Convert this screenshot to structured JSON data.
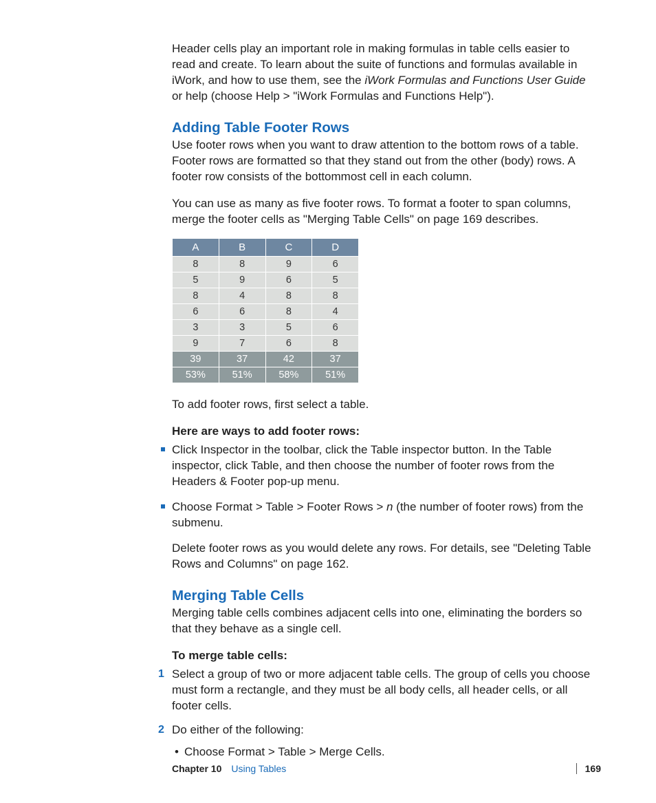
{
  "intro_para": {
    "pre": "Header cells play an important role in making formulas in table cells easier to read and create. To learn about the suite of functions and formulas available in iWork, and how to use them, see the ",
    "ital": "iWork Formulas and Functions User Guide",
    "post": " or help (choose Help > \"iWork Formulas and Functions Help\")."
  },
  "section1": {
    "heading": "Adding Table Footer Rows",
    "p1": "Use footer rows when you want to draw attention to the bottom rows of a table. Footer rows are formatted so that they stand out from the other (body) rows. A footer row consists of the bottommost cell in each column.",
    "p2": "You can use as many as five footer rows. To format a footer to span columns, merge the footer cells as \"Merging Table Cells\" on page 169 describes.",
    "after_table": "To add footer rows, first select a table.",
    "ways_heading": "Here are ways to add footer rows:",
    "bullets": [
      "Click Inspector in the toolbar, click the Table inspector button. In the Table inspector, click Table, and then choose the number of footer rows from the Headers & Footer pop-up menu.",
      {
        "pre": "Choose Format > Table > Footer Rows > ",
        "ital": "n",
        "post": " (the number of footer rows) from the submenu."
      }
    ],
    "delete_para": "Delete footer rows as you would delete any rows. For details, see \"Deleting Table Rows and Columns\" on page 162."
  },
  "table": {
    "headers": [
      "A",
      "B",
      "C",
      "D"
    ],
    "rows": [
      [
        "8",
        "8",
        "9",
        "6"
      ],
      [
        "5",
        "9",
        "6",
        "5"
      ],
      [
        "8",
        "4",
        "8",
        "8"
      ],
      [
        "6",
        "6",
        "8",
        "4"
      ],
      [
        "3",
        "3",
        "5",
        "6"
      ],
      [
        "9",
        "7",
        "6",
        "8"
      ]
    ],
    "footer_rows": [
      [
        "39",
        "37",
        "42",
        "37"
      ],
      [
        "53%",
        "51%",
        "58%",
        "51%"
      ]
    ]
  },
  "section2": {
    "heading": "Merging Table Cells",
    "p1": "Merging table cells combines adjacent cells into one, eliminating the borders so that they behave as a single cell.",
    "steps_heading": "To merge table cells:",
    "steps": [
      "Select a group of two or more adjacent table cells. The group of cells you choose must form a rectangle, and they must be all body cells, all header cells, or all footer cells.",
      "Do either of the following:"
    ],
    "substeps": [
      "Choose Format > Table > Merge Cells."
    ]
  },
  "footer": {
    "chapter_label": "Chapter 10",
    "chapter_title": "Using Tables",
    "page": "169"
  }
}
